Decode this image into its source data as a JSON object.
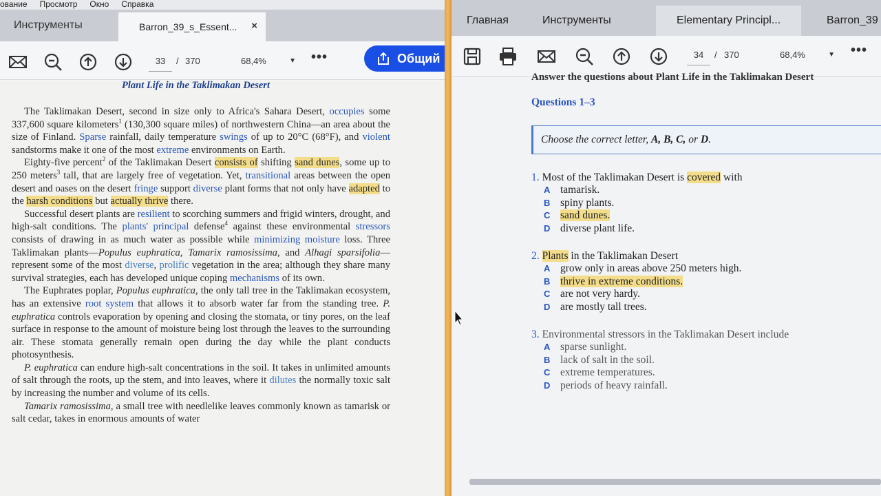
{
  "left_window": {
    "menu": [
      "ование",
      "Просмотр",
      "Окно",
      "Справка"
    ],
    "tabs": {
      "tools": "Инструменты",
      "document": "Barron_39_s_Essent...",
      "close": "×"
    },
    "toolbar": {
      "page_current": "33",
      "page_separator": "/",
      "page_total": "370",
      "zoom": "68,4%",
      "zoom_caret": "▼",
      "more": "•••",
      "share_label": "Общий"
    },
    "page": {
      "title": "Plant Life in the Taklimakan Desert",
      "p1": {
        "a": "The Taklimakan Desert, second in size only to Africa's Sahara Desert,",
        "occupies": "occupies",
        "b": " some 337,600 square kilometers",
        "sup": "1",
        "c": " (130,300 square miles) of northwestern China—an area about the size of Finland. ",
        "sparse": "Sparse",
        "d": " rainfall, daily temperature ",
        "swings": "swings",
        "e": " of up to 20°C (68°F), and ",
        "violent": "violent",
        "f": " sandstorms make it one of the most ",
        "extreme": "extreme",
        "g": " environments on Earth."
      },
      "p2": {
        "a": "Eighty-five percent",
        "sup": "2",
        "b": " of the Taklimakan Desert ",
        "consists": "consists of",
        "c": " shifting ",
        "sand_dunes": "sand dunes",
        "d": ", some up to 250 meters",
        "sup2": "3",
        "e": " tall, that are largely free of vegetation. Yet, ",
        "transitional": "transitional",
        "f": " areas between the open desert and oases on the desert ",
        "fringe": "fringe",
        "g": " support ",
        "diverse": "diverse",
        "h": " plant forms that not only have ",
        "adapted": "adapted",
        "i": " to the ",
        "harsh": "harsh conditions",
        "j": " but ",
        "thrive": "actually thrive",
        "k": " there."
      },
      "p3": {
        "a": "Successful desert plants are ",
        "resilient": "resilient",
        "b": " to scorching summers and frigid winters, drought, and high-salt conditions. The ",
        "principal": "plants' principal",
        "c": " defense",
        "sup": "4",
        "d": " against these environmental ",
        "stressors": "stressors",
        "e": " consists of drawing in as much water as possible while ",
        "minimizing": "minimizing moisture",
        "f": " loss. Three Taklimakan plants—",
        "sp1": "Populus euphratica",
        "g": ", ",
        "sp2": "Tamarix ramosissima",
        "h": ", and ",
        "sp3": "Alhagi sparsifolia",
        "i": "—represent some of the most ",
        "diverse": "diverse",
        "j": ", ",
        "prolific": "prolific",
        "k": " vegetation in the area; although they share many survival strategies, each has developed unique coping ",
        "mechanisms": "mechanisms",
        "l": " of its own."
      },
      "p4": {
        "a": "The Euphrates poplar, ",
        "sp": "Populus euphratica",
        "b": ", the only tall tree in the Taklimakan ecosystem, has an extensive ",
        "root": "root system",
        "c": " that allows it to absorb water far from the standing tree. ",
        "sp2": "P. euphratica",
        "d": " controls evaporation by opening and closing the stomata, or tiny pores, on the leaf surface in response to the amount of moisture being lost through the leaves to the surrounding air. These stomata generally remain open during the day while the plant conducts photosynthesis."
      },
      "p5": {
        "sp": "P. euphratica",
        "a": " can endure high-salt concentrations in the soil. It takes in unlimited amounts of salt through the roots, up the stem, and into leaves, where it ",
        "dilutes": "dilutes",
        "b": " the normally toxic salt by increasing the number and volume of its cells."
      },
      "p6": {
        "sp": "Tamarix ramosissima",
        "a": ", a small tree with needlelike leaves commonly known as tamarisk or salt cedar, takes in enormous amounts of water"
      }
    }
  },
  "right_window": {
    "tabs": [
      "Главная",
      "Инструменты",
      "Elementary Principl...",
      "Barron_39"
    ],
    "toolbar": {
      "page_current": "34",
      "page_separator": "/",
      "page_total": "370",
      "zoom": "68,4%",
      "zoom_caret": "▼",
      "more": "•••"
    },
    "page": {
      "cut_line": "Answer the questions about Plant Life in the Taklimakan Desert",
      "heading": "Questions 1–3",
      "instruction_a": "Choose the correct letter, ",
      "instruction_letters": "A, B, C,",
      "instruction_b": " or ",
      "instruction_d": "D",
      "instruction_c": ".",
      "questions": [
        {
          "num": "1.",
          "stem_a": "Most of the Taklimakan Desert is ",
          "stem_hl": "covered",
          "stem_b": " with",
          "options": [
            {
              "letter": "A",
              "text": "tamarisk."
            },
            {
              "letter": "B",
              "text": "spiny plants."
            },
            {
              "letter": "C",
              "text": "sand dunes."
            },
            {
              "letter": "D",
              "text": "diverse plant life."
            }
          ]
        },
        {
          "num": "2.",
          "stem_a": "",
          "stem_hl": "Plants",
          "stem_b": " in the Taklimakan Desert",
          "options": [
            {
              "letter": "A",
              "text": "grow only in areas above 250 meters high."
            },
            {
              "letter": "B",
              "text": "thrive in extreme conditions."
            },
            {
              "letter": "C",
              "text": "are not very hardy."
            },
            {
              "letter": "D",
              "text": "are mostly tall trees."
            }
          ]
        },
        {
          "num": "3.",
          "stem_a": "Environmental stressors in the Taklimakan Desert include",
          "stem_hl": "",
          "stem_b": "",
          "options": [
            {
              "letter": "A",
              "text": "sparse sunlight."
            },
            {
              "letter": "B",
              "text": "lack of salt in the soil."
            },
            {
              "letter": "C",
              "text": "extreme temperatures."
            },
            {
              "letter": "D",
              "text": "periods of heavy rainfall."
            }
          ]
        }
      ]
    }
  },
  "colors": {
    "accent_blue": "#1a4fe6",
    "highlight": "#f3dd8a",
    "divider_orange": "#e5a44a",
    "link_blue": "#2a55c4"
  }
}
